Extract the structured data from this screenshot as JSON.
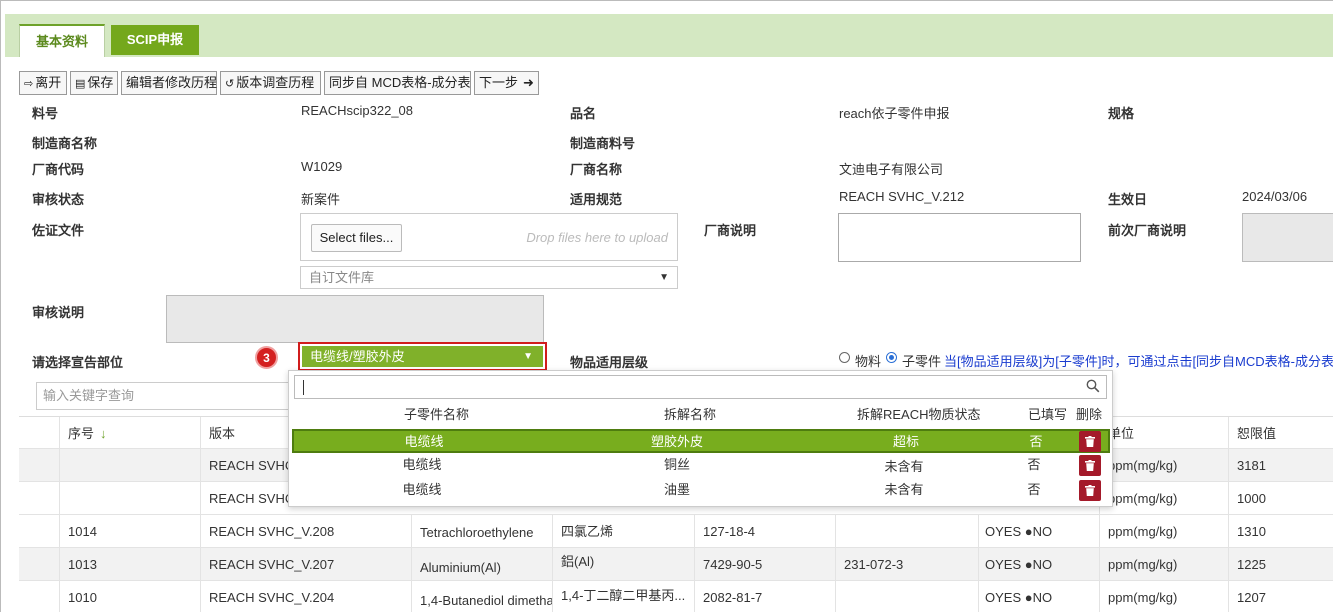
{
  "tabs": [
    {
      "label": "基本资料",
      "active": true
    },
    {
      "label": "SCIP申报",
      "active": false
    }
  ],
  "toolbar": {
    "leave": "离开",
    "save": "保存",
    "editor_history": "编辑者修改历程",
    "version_history": "版本调查历程",
    "sync_mcd": "同步自 MCD表格-成分表",
    "next": "下一步"
  },
  "form": {
    "part_no_label": "料号",
    "part_no": "REACHscip322_08",
    "product_name_label": "品名",
    "product_name": "reach依子零件申报",
    "spec_label": "规格",
    "maker_name_label": "制造商名称",
    "maker_part_label": "制造商料号",
    "vendor_code_label": "厂商代码",
    "vendor_code": "W1029",
    "vendor_name_label": "厂商名称",
    "vendor_name": "文迪电子有限公司",
    "review_status_label": "审核状态",
    "review_status": "新案件",
    "regulation_label": "适用规范",
    "regulation": "REACH SVHC_V.212",
    "effective_label": "生效日",
    "effective_date": "2024/03/06",
    "evidence_label": "佐证文件",
    "select_files": "Select files...",
    "drop_files": "Drop files here to upload",
    "custom_lib": "自订文件库",
    "vendor_note_label": "厂商说明",
    "prev_vendor_note_label": "前次厂商说明",
    "review_note_label": "审核说明",
    "declare_part_label": "请选择宣告部位",
    "declare_part_value": "电缆线/塑胶外皮",
    "badge": "3",
    "level_label": "物品适用层级",
    "level_opt1": "物料",
    "level_opt2": "子零件",
    "level_hint": "当[物品适用层级]为[子零件]时，可通过点击[同步自MCD表格-成分表"
  },
  "search": {
    "placeholder": "输入关键字查询"
  },
  "table": {
    "headers": [
      "",
      "序号",
      "版本",
      "",
      "",
      "",
      "",
      "",
      "单位",
      "恕限值"
    ],
    "rows": [
      [
        "",
        "",
        "REACH SVHC",
        "",
        "",
        "",
        "",
        "",
        "ppm(mg/kg)",
        "3181"
      ],
      [
        "",
        "",
        "REACH SVHC",
        "",
        "",
        "",
        "",
        "",
        "ppm(mg/kg)",
        "1000"
      ],
      [
        "",
        "1014",
        "REACH SVHC_V.208",
        "Tetrachloroethylene",
        "四氯乙烯",
        "127-18-4",
        "",
        "OYES ●NO",
        "ppm(mg/kg)",
        "1310"
      ],
      [
        "",
        "1013",
        "REACH SVHC_V.207",
        "Aluminium(Al)",
        "鋁(Al)",
        "7429-90-5",
        "231-072-3",
        "OYES ●NO",
        "ppm(mg/kg)",
        "1225"
      ],
      [
        "",
        "1010",
        "REACH SVHC_V.204",
        "1,4-Butanediol dimetha",
        "1,4-丁二醇二甲基丙...",
        "2082-81-7",
        "",
        "OYES ●NO",
        "ppm(mg/kg)",
        "1207"
      ]
    ]
  },
  "popup": {
    "headers": {
      "sub_part": "子零件名称",
      "disassembly": "拆解名称",
      "reach_status": "拆解REACH物质状态",
      "filled": "已填写",
      "delete": "删除"
    },
    "rows": [
      {
        "sub_part": "电缆线",
        "disassembly": "塑胶外皮",
        "status": "超标",
        "filled": "否",
        "selected": true
      },
      {
        "sub_part": "电缆线",
        "disassembly": "铜丝",
        "status": "未含有",
        "filled": "否",
        "selected": false
      },
      {
        "sub_part": "电缆线",
        "disassembly": "油墨",
        "status": "未含有",
        "filled": "否",
        "selected": false
      }
    ]
  },
  "colors": {
    "accent_green": "#80b12a",
    "tab_bar": "#d4e8c2",
    "highlight_red": "#d11c1c",
    "delete_red": "#a41a2a",
    "hint_blue": "#1a3ccf"
  },
  "icons": [
    "exit-icon",
    "save-icon",
    "history-icon",
    "arrow-right-icon",
    "search-icon",
    "trash-icon",
    "sort-down-icon",
    "caret-down-icon"
  ]
}
